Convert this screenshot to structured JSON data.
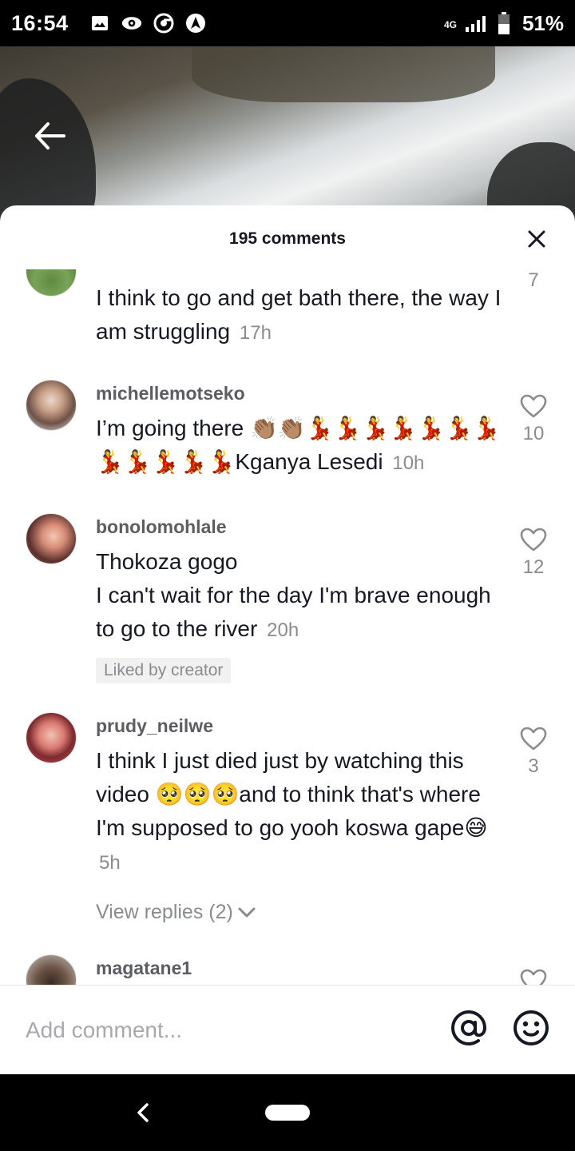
{
  "status_bar": {
    "time": "16:54",
    "network": "4G",
    "battery": "51%"
  },
  "sheet": {
    "title": "195 comments"
  },
  "comments": [
    {
      "username": "",
      "text": "I think to go and get bath there, the way I am struggling",
      "time": "17h",
      "likes": "7"
    },
    {
      "username": "michellemotseko",
      "text": "I’m going there 👏🏽👏🏽💃💃💃💃💃💃💃💃💃💃💃💃Kganya Lesedi",
      "time": "10h",
      "likes": "10"
    },
    {
      "username": "bonolomohlale",
      "text_lines": [
        "Thokoza gogo",
        "I can't wait for the day I'm brave enough to go to the river"
      ],
      "time": "20h",
      "likes": "12",
      "badge": "Liked by creator"
    },
    {
      "username": "prudy_neilwe",
      "text": "I think I just died just by watching this video 🥺🥺🥺and to think that's where I'm supposed to go yooh koswa gape😅",
      "time": "5h",
      "likes": "3",
      "view_replies": "View replies (2)"
    },
    {
      "username": "magatane1"
    }
  ],
  "input": {
    "placeholder": "Add comment..."
  },
  "colors": {
    "text": "#161823",
    "muted": "#8a8b91",
    "username": "#5c5d63"
  }
}
